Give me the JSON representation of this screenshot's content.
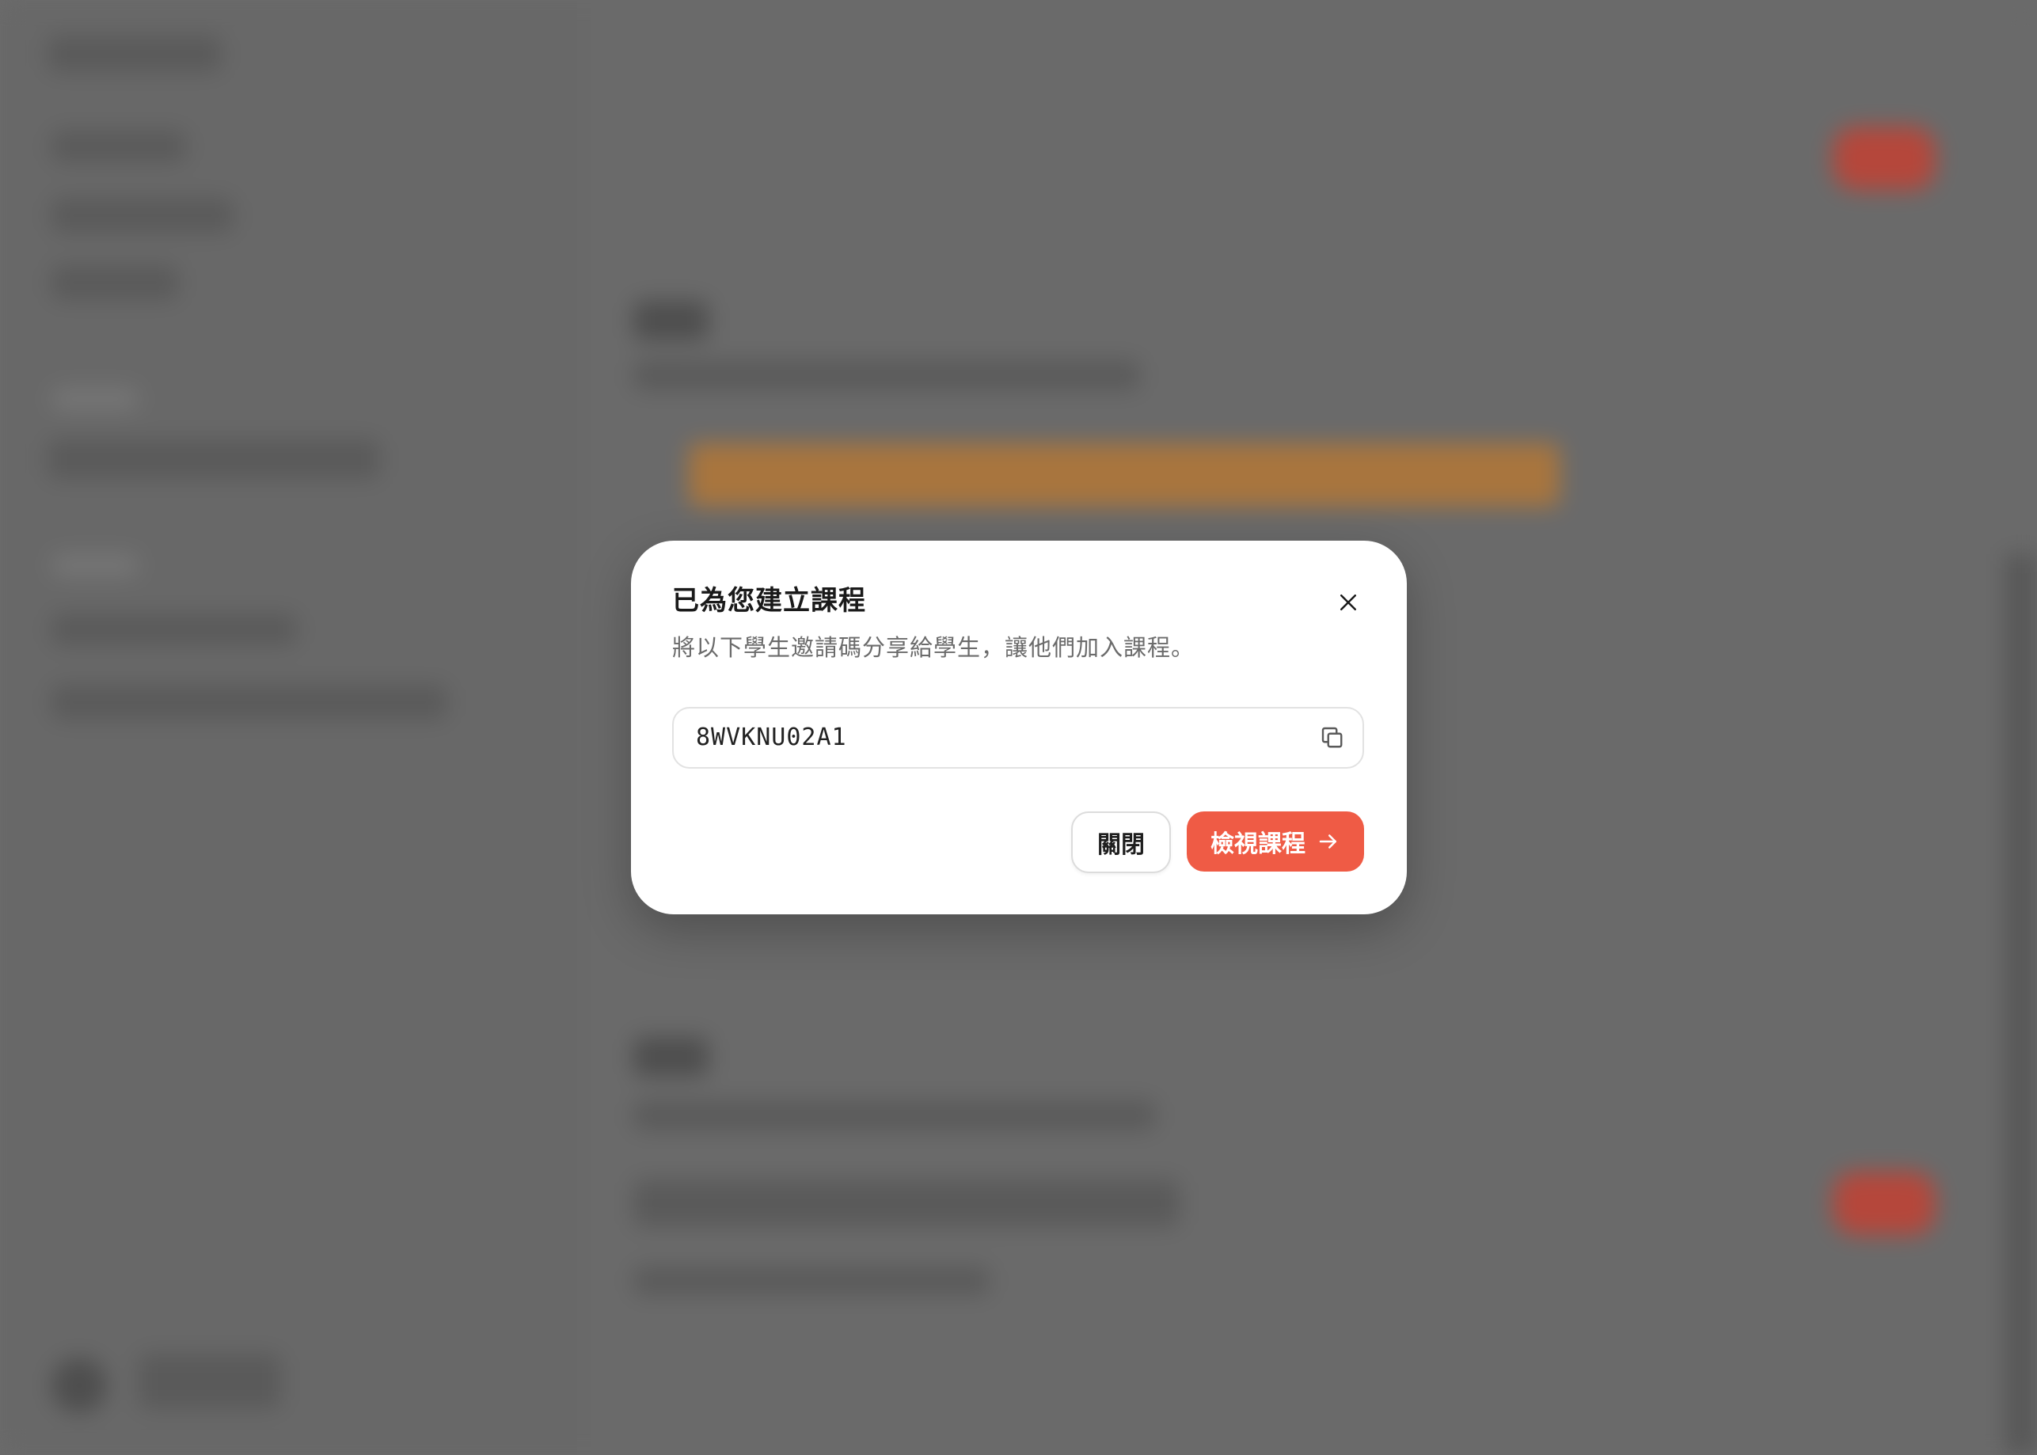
{
  "modal": {
    "title": "已為您建立課程",
    "description": "將以下學生邀請碼分享給學生，讓他們加入課程。",
    "invite_code": "8WVKNU02A1",
    "close_label": "關閉",
    "view_course_label": "檢視課程"
  },
  "colors": {
    "accent": "#ef5b45",
    "overlay": "#6b6b6b",
    "dialog_background": "#ffffff"
  },
  "icons": {
    "close": "close-icon",
    "copy": "copy-icon",
    "arrow": "arrow-right-icon"
  }
}
